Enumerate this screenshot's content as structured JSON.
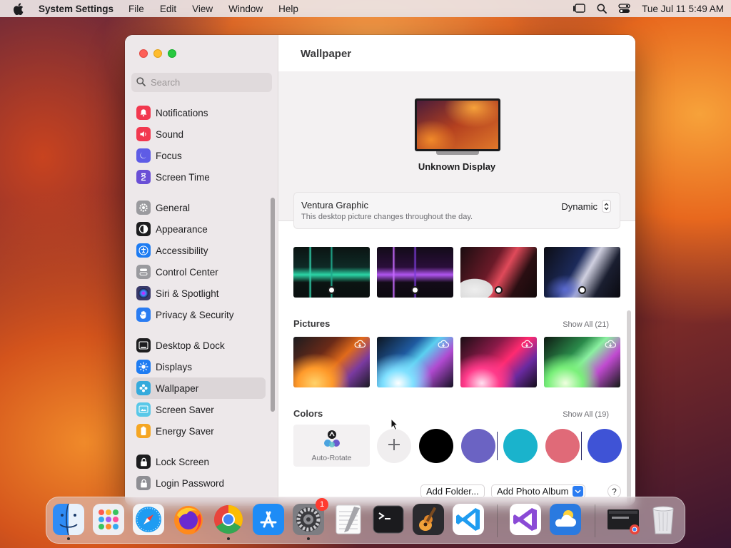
{
  "menubar": {
    "app_name": "System Settings",
    "menus": [
      "File",
      "Edit",
      "View",
      "Window",
      "Help"
    ],
    "clock": "Tue Jul 11  5:49 AM"
  },
  "sidebar": {
    "search_placeholder": "Search",
    "groups": [
      [
        {
          "label": "Notifications",
          "icon": "bell-icon",
          "color": "#f2384f"
        },
        {
          "label": "Sound",
          "icon": "speaker-icon",
          "color": "#f2384f"
        },
        {
          "label": "Focus",
          "icon": "moon-icon",
          "color": "#5e5ce6"
        },
        {
          "label": "Screen Time",
          "icon": "hourglass-icon",
          "color": "#6a4fd6"
        }
      ],
      [
        {
          "label": "General",
          "icon": "gear-icon",
          "color": "#9a9a9e"
        },
        {
          "label": "Appearance",
          "icon": "appearance-icon",
          "color": "#1d1d1f"
        },
        {
          "label": "Accessibility",
          "icon": "accessibility-icon",
          "color": "#1e7cf2"
        },
        {
          "label": "Control Center",
          "icon": "control-center-icon",
          "color": "#9a9a9e"
        },
        {
          "label": "Siri & Spotlight",
          "icon": "siri-icon",
          "color": "#3a3a6a"
        },
        {
          "label": "Privacy & Security",
          "icon": "hand-icon",
          "color": "#2a7cf2"
        }
      ],
      [
        {
          "label": "Desktop & Dock",
          "icon": "dock-icon",
          "color": "#1d1d1f"
        },
        {
          "label": "Displays",
          "icon": "sun-icon",
          "color": "#1e7cf2"
        },
        {
          "label": "Wallpaper",
          "icon": "wallpaper-icon",
          "color": "#34aadc",
          "selected": true
        },
        {
          "label": "Screen Saver",
          "icon": "screen-saver-icon",
          "color": "#5ac8e8"
        },
        {
          "label": "Energy Saver",
          "icon": "battery-icon",
          "color": "#f5a623"
        }
      ],
      [
        {
          "label": "Lock Screen",
          "icon": "lock-icon",
          "color": "#1d1d1f"
        },
        {
          "label": "Login Password",
          "icon": "key-icon",
          "color": "#8e8e93"
        }
      ]
    ]
  },
  "content": {
    "title": "Wallpaper",
    "display_name": "Unknown Display",
    "wallpaper": {
      "name": "Ventura Graphic",
      "description": "This desktop picture changes throughout the day.",
      "mode": "Dynamic"
    },
    "pictures": {
      "title": "Pictures",
      "show_all": "Show All (21)"
    },
    "colors": {
      "title": "Colors",
      "show_all": "Show All (19)",
      "auto_rotate_label": "Auto-Rotate",
      "swatches": [
        "#000000",
        "#6b63c3",
        "#1ab3cc",
        "#e06a78",
        "#3f53d6"
      ]
    },
    "buttons": {
      "add_folder": "Add Folder...",
      "add_photo_album": "Add Photo Album",
      "help": "?"
    }
  },
  "dock": {
    "apps": [
      {
        "name": "Finder",
        "icon": "finder-icon",
        "running": true
      },
      {
        "name": "Launchpad",
        "icon": "launchpad-icon",
        "running": false
      },
      {
        "name": "Safari",
        "icon": "safari-icon",
        "running": false
      },
      {
        "name": "Firefox",
        "icon": "firefox-icon",
        "running": false
      },
      {
        "name": "Chrome",
        "icon": "chrome-icon",
        "running": true
      },
      {
        "name": "App Store",
        "icon": "app-store-icon",
        "running": false
      },
      {
        "name": "System Settings",
        "icon": "system-settings-icon",
        "running": true,
        "badge": "1"
      },
      {
        "name": "TextEdit",
        "icon": "textedit-icon",
        "running": false
      },
      {
        "name": "Terminal",
        "icon": "terminal-icon",
        "running": false
      },
      {
        "name": "GarageBand",
        "icon": "garageband-icon",
        "running": false
      },
      {
        "name": "VS Code",
        "icon": "vscode-icon",
        "running": false
      },
      {
        "name": "Visual Studio",
        "icon": "visual-studio-icon",
        "running": false
      },
      {
        "name": "Weather",
        "icon": "weather-icon",
        "running": false
      },
      {
        "name": "Chrome Window",
        "icon": "chrome-window-icon",
        "running": false
      },
      {
        "name": "Trash",
        "icon": "trash-icon",
        "running": false
      }
    ]
  }
}
